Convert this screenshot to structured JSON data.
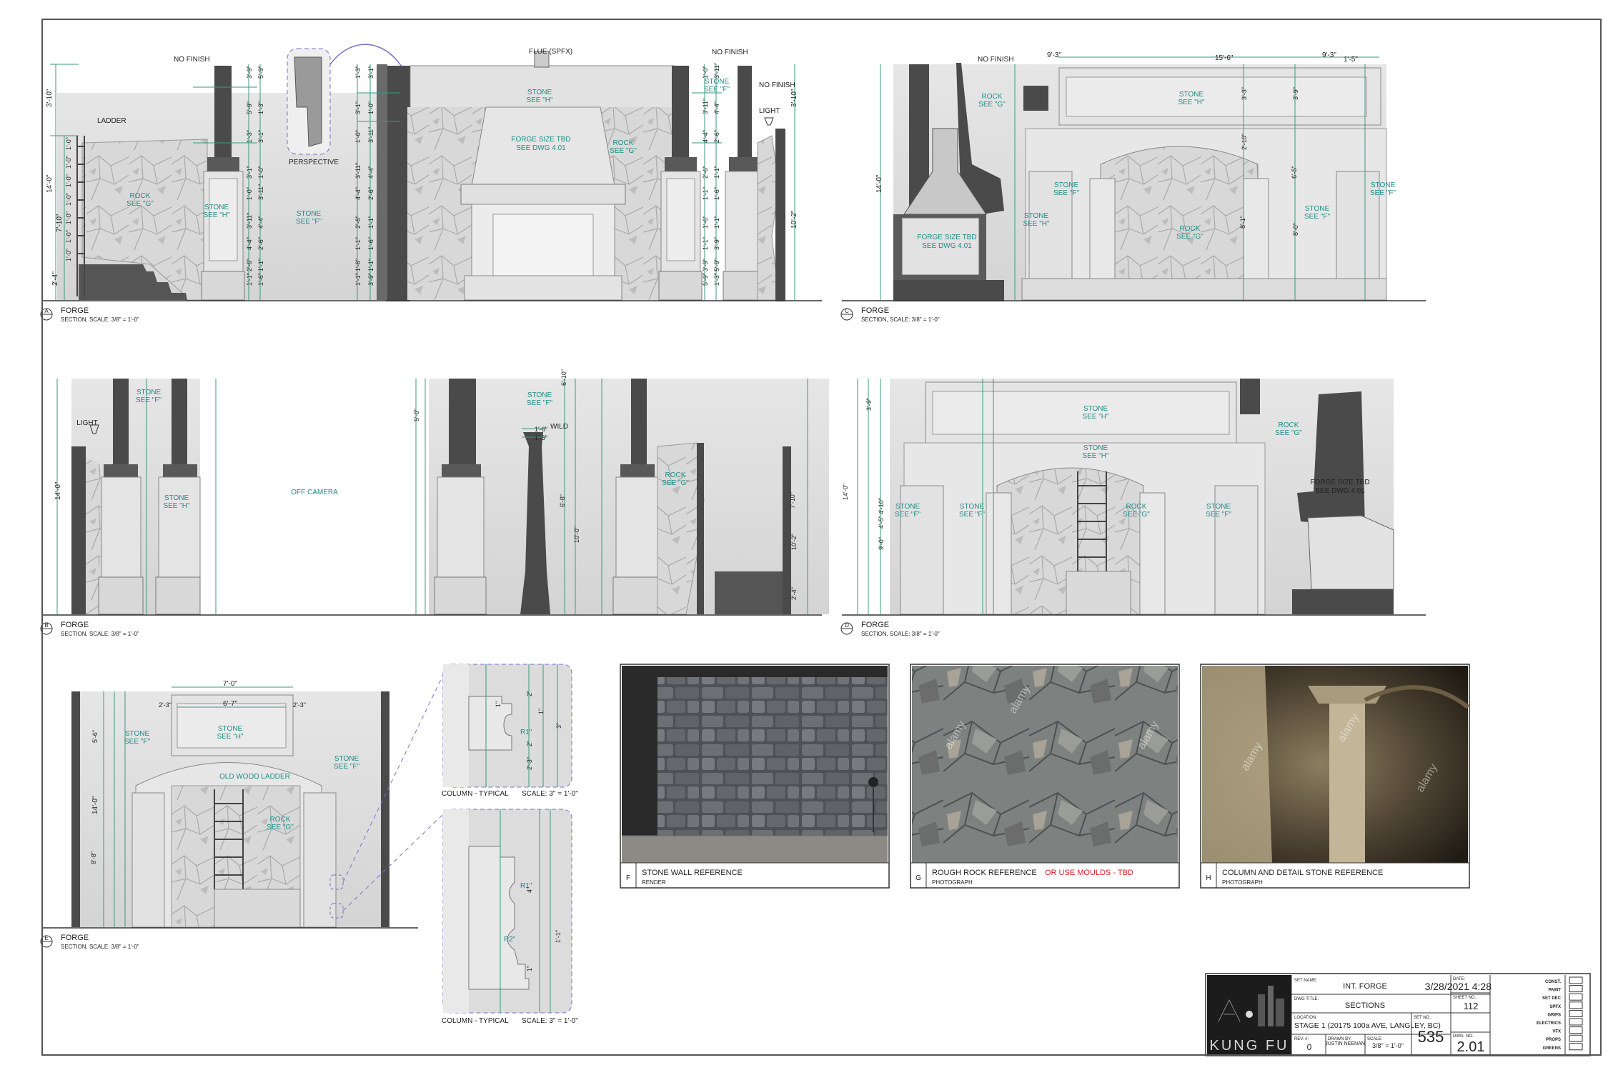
{
  "sheet": {
    "views": {
      "A": {
        "letter": "A",
        "title": "FORGE",
        "scale": "SECTION, SCALE: 3/8\" = 1'-0\""
      },
      "B": {
        "letter": "B",
        "title": "FORGE",
        "scale": "SECTION, SCALE: 3/8\" = 1'-0\""
      },
      "C": {
        "letter": "C",
        "title": "FORGE",
        "scale": "SECTION, SCALE: 3/8\" = 1'-0\""
      },
      "D": {
        "letter": "D",
        "title": "FORGE",
        "scale": "SECTION, SCALE: 3/8\" = 1'-0\""
      },
      "E": {
        "letter": "E",
        "title": "FORGE",
        "scale": "SECTION, SCALE: 3/8\" = 1'-0\""
      }
    },
    "labels": {
      "no_finish": "NO FINISH",
      "flue": "FLUE (SPFX)",
      "ladder": "LADDER",
      "light": "LIGHT",
      "perspective": "PERSPECTIVE",
      "stone": "STONE",
      "see_h": "SEE \"H\"",
      "see_f": "SEE \"F\"",
      "see_g": "SEE \"G\"",
      "rock": "ROCK",
      "forge_size": "FORGE SIZE TBD",
      "see_dwg": "SEE DWG 4.01",
      "off_camera": "OFF CAMERA",
      "wild": "WILD",
      "old_wood_ladder": "OLD WOOD LADDER",
      "column_typical": "COLUMN - TYPICAL",
      "column_scale": "SCALE: 3\" = 1'-0\"",
      "r1": "R1\"",
      "r2": "R2\""
    },
    "dims": {
      "a_left": [
        "3'-10\"",
        "14'-0\"",
        "7'-10\"",
        "2'-4\""
      ],
      "a_ladder": [
        "1'-0\"",
        "1'-0\"",
        "1'-0\"",
        "1'-0\"",
        "1'-0\"",
        "1'-0\"",
        "1'-0\""
      ],
      "col": [
        "3'-9\"",
        "5'-9\"",
        "1'-3\"",
        "3'-1\"",
        "1'-0\"",
        "3'-11\"",
        "4'-4\"",
        "2'-6\"",
        "1'-1\"",
        "1'-6\"",
        "1'-1\""
      ],
      "a_right": [
        "3'-10\"",
        "10'-2\""
      ],
      "c_top": [
        "9'-3\"",
        "15'-6\"",
        "9'-3\"",
        "1'-5\""
      ],
      "c_mid": [
        "3'-3\"",
        "2'-10\"",
        "3'-9\"",
        "8'-0\"",
        "6'-5\"",
        "8'-1\""
      ],
      "b_off": [
        "5'-0\"",
        "6'-8\"",
        "10'-0\"",
        "6'-10\"",
        "1'-6\"",
        "1'-5\"",
        "7'-10\"",
        "10'-2\"",
        "2'-4\""
      ],
      "d_left": [
        "14'-0\"",
        "3'-9\"",
        "9'-0\"",
        "4'-10\"",
        "4'-5\""
      ],
      "e_top": [
        "7'-0\"",
        "6'-7\"",
        "2'-3\"",
        "2'-3\"",
        "5'-6\"",
        "14'-0\"",
        "8'-8\""
      ],
      "column_detail": [
        "1\"",
        "2\"",
        "1\"",
        "2\"",
        "3\"",
        "2'-3\"",
        "4\"",
        "1'-1\"",
        "1\""
      ]
    },
    "references": [
      {
        "letter": "F",
        "title": "STONE WALL REFERENCE",
        "extra": "",
        "subtitle": "RENDER"
      },
      {
        "letter": "G",
        "title": "ROUGH ROCK REFERENCE",
        "extra": "OR USE MOULDS - TBD",
        "subtitle": "PHOTOGRAPH"
      },
      {
        "letter": "H",
        "title": "COLUMN AND DETAIL STONE REFERENCE",
        "extra": "",
        "subtitle": "PHOTOGRAPH"
      }
    ],
    "watermark": "alamy",
    "title_block": {
      "logo_text": "KUNG FU",
      "set_name_label": "SET NAME:",
      "set_name": "INT. FORGE",
      "dwg_title_label": "DWG TITLE:",
      "dwg_title": "SECTIONS",
      "location_label": "LOCATION:",
      "location": "STAGE 1 (20175 100a AVE, LANGLEY, BC)",
      "rev_label": "REV. #:",
      "rev": "0",
      "drawn_label": "DRAWN BY:",
      "drawn_by": "JUSTIN NEENAN",
      "scale_label": "SCALE:",
      "scale": "3/8\" = 1'-0\"",
      "set_no_label": "SET NO.:",
      "set_no": "535",
      "date_label": "DATE:",
      "date": "3/28/2021 4:28",
      "sheet_label": "SHEET NO.:",
      "sheet_no": "112",
      "dwg_no_label": "DWG. NO.:",
      "dwg_no": "2.01",
      "departments": [
        "CONST.",
        "PAINT",
        "SET DEC",
        "SPFX",
        "GRIPS",
        "ELECTRICS",
        "VFX",
        "PROPS",
        "GREENS"
      ]
    }
  }
}
